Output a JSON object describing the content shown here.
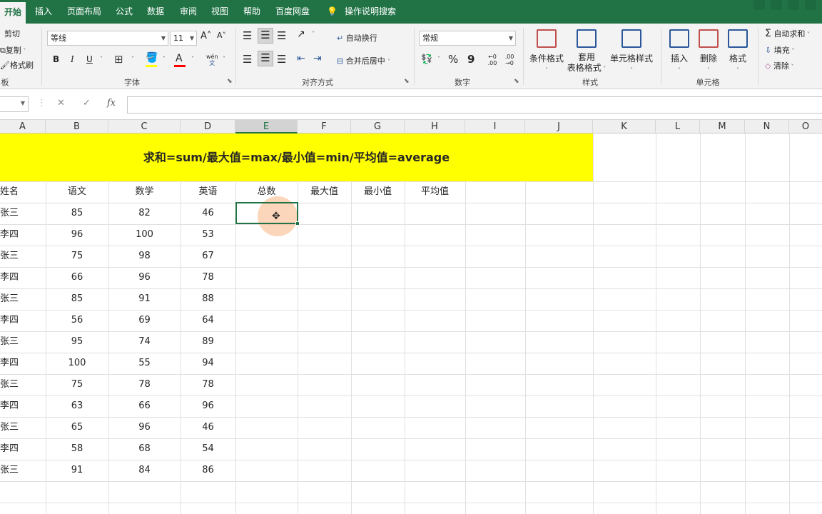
{
  "tabs": [
    "开始",
    "插入",
    "页面布局",
    "公式",
    "数据",
    "审阅",
    "视图",
    "帮助",
    "百度网盘"
  ],
  "tell_me": "操作说明搜索",
  "clipboard": {
    "cut": "剪切",
    "copy": "复制",
    "format_painter": "格式刷",
    "group_label": "板"
  },
  "font": {
    "name": "等线",
    "size": "11",
    "group_label": "字体",
    "bold": "B",
    "italic": "I",
    "underline": "U",
    "grow": "A˄",
    "shrink": "A˅",
    "font_color": "A",
    "phonetic": "wén"
  },
  "alignment": {
    "wrap_text": "自动换行",
    "merge_center": "合并后居中",
    "group_label": "对齐方式"
  },
  "number": {
    "format": "常规",
    "group_label": "数字",
    "percent": "%",
    "comma": "9",
    "inc_dec": "←0 .00",
    "dec_dec": ".00 →0"
  },
  "styles": {
    "conditional": "条件格式",
    "table_format_1": "套用",
    "table_format_2": "表格格式",
    "cell_styles": "单元格样式",
    "group_label": "样式"
  },
  "cells_group": {
    "insert": "插入",
    "delete": "删除",
    "format": "格式",
    "group_label": "单元格"
  },
  "editing": {
    "autosum": "自动求和",
    "fill": "填充",
    "clear": "清除"
  },
  "formula_bar": {
    "fx": "fx",
    "cancel": "✕",
    "enter": "✓"
  },
  "columns": [
    "A",
    "B",
    "C",
    "D",
    "E",
    "F",
    "G",
    "H",
    "I",
    "J",
    "K",
    "L",
    "M",
    "N",
    "O"
  ],
  "sheet": {
    "banner": "求和=sum/最大值=max/最小值=min/平均值=average",
    "headers": [
      "姓名",
      "语文",
      "数学",
      "英语",
      "总数",
      "最大值",
      "最小值",
      "平均值"
    ],
    "rows": [
      [
        "张三",
        "85",
        "82",
        "46"
      ],
      [
        "李四",
        "96",
        "100",
        "53"
      ],
      [
        "张三",
        "75",
        "98",
        "67"
      ],
      [
        "李四",
        "66",
        "96",
        "78"
      ],
      [
        "张三",
        "85",
        "91",
        "88"
      ],
      [
        "李四",
        "56",
        "69",
        "64"
      ],
      [
        "张三",
        "95",
        "74",
        "89"
      ],
      [
        "李四",
        "100",
        "55",
        "94"
      ],
      [
        "张三",
        "75",
        "78",
        "78"
      ],
      [
        "李四",
        "63",
        "66",
        "96"
      ],
      [
        "张三",
        "65",
        "96",
        "46"
      ],
      [
        "李四",
        "58",
        "68",
        "54"
      ],
      [
        "张三",
        "91",
        "84",
        "86"
      ]
    ]
  },
  "colors": {
    "excel_green": "#217346",
    "banner": "#ffff00",
    "cursor_highlight": "#fab482"
  }
}
